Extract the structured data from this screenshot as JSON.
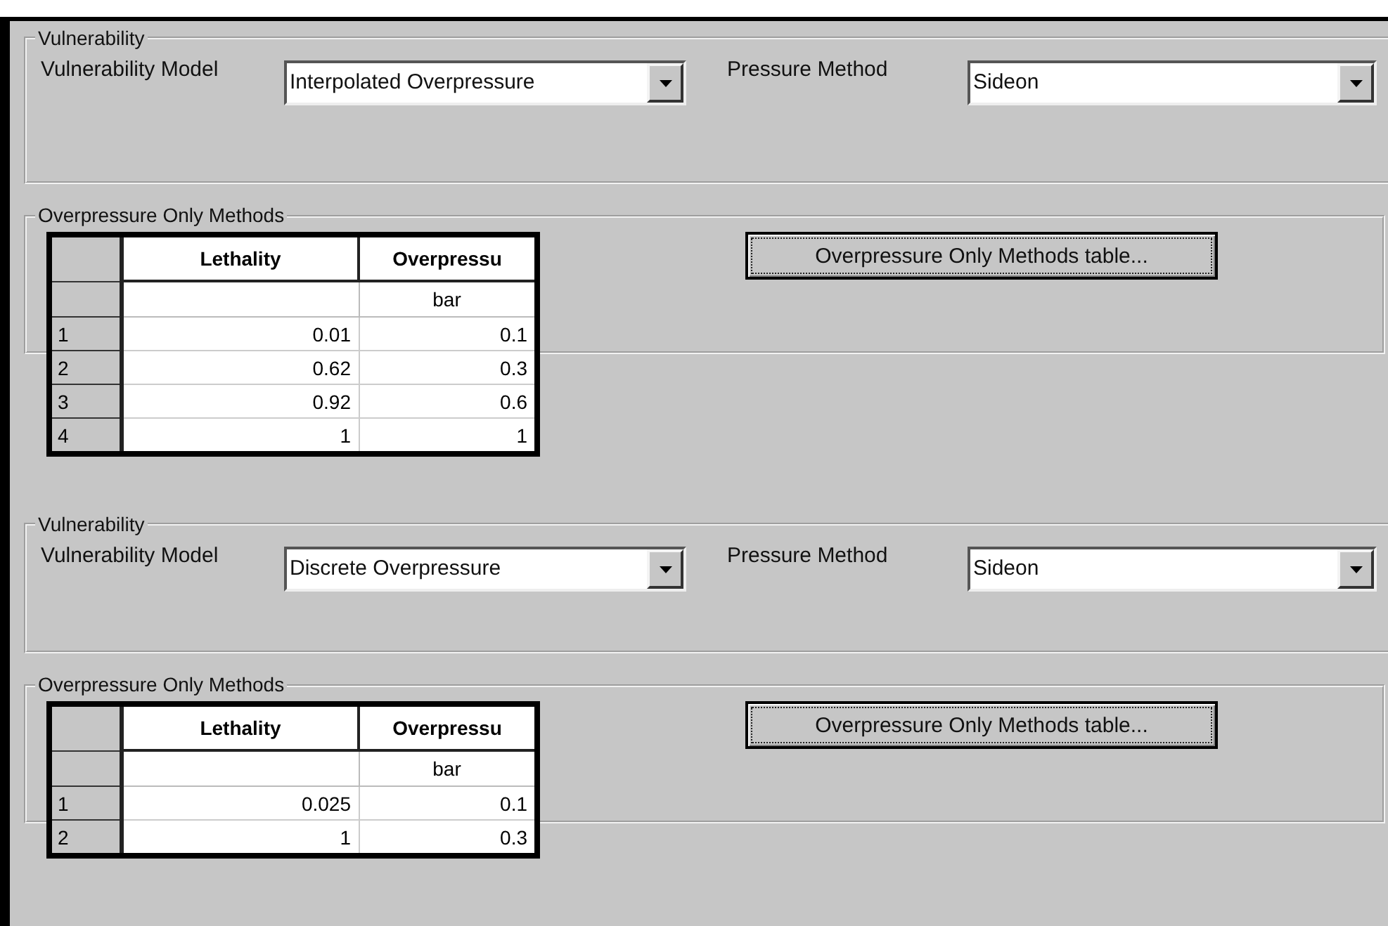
{
  "panels": [
    {
      "vulnerability": {
        "title": "Vulnerability",
        "model_label": "Vulnerability Model",
        "model_value": "Interpolated Overpressure",
        "pressure_label": "Pressure Method",
        "pressure_value": "Sideon"
      },
      "methods": {
        "title": "Overpressure Only Methods",
        "columns": [
          {
            "label": "Lethality"
          },
          {
            "label": "Overpressu",
            "unit": "bar"
          }
        ],
        "rows": [
          {
            "index": "1",
            "cells": [
              "0.01",
              "0.1"
            ]
          },
          {
            "index": "2",
            "cells": [
              "0.62",
              "0.3"
            ]
          },
          {
            "index": "3",
            "cells": [
              "0.92",
              "0.6"
            ]
          },
          {
            "index": "4",
            "cells": [
              "1",
              "1"
            ]
          }
        ],
        "button": "Overpressure Only Methods table..."
      }
    },
    {
      "vulnerability": {
        "title": "Vulnerability",
        "model_label": "Vulnerability Model",
        "model_value": "Discrete Overpressure",
        "pressure_label": "Pressure Method",
        "pressure_value": "Sideon"
      },
      "methods": {
        "title": "Overpressure Only Methods",
        "columns": [
          {
            "label": "Lethality"
          },
          {
            "label": "Overpressu",
            "unit": "bar"
          }
        ],
        "rows": [
          {
            "index": "1",
            "cells": [
              "0.025",
              "0.1"
            ]
          },
          {
            "index": "2",
            "cells": [
              "1",
              "0.3"
            ]
          }
        ],
        "button": "Overpressure Only Methods table..."
      }
    }
  ]
}
